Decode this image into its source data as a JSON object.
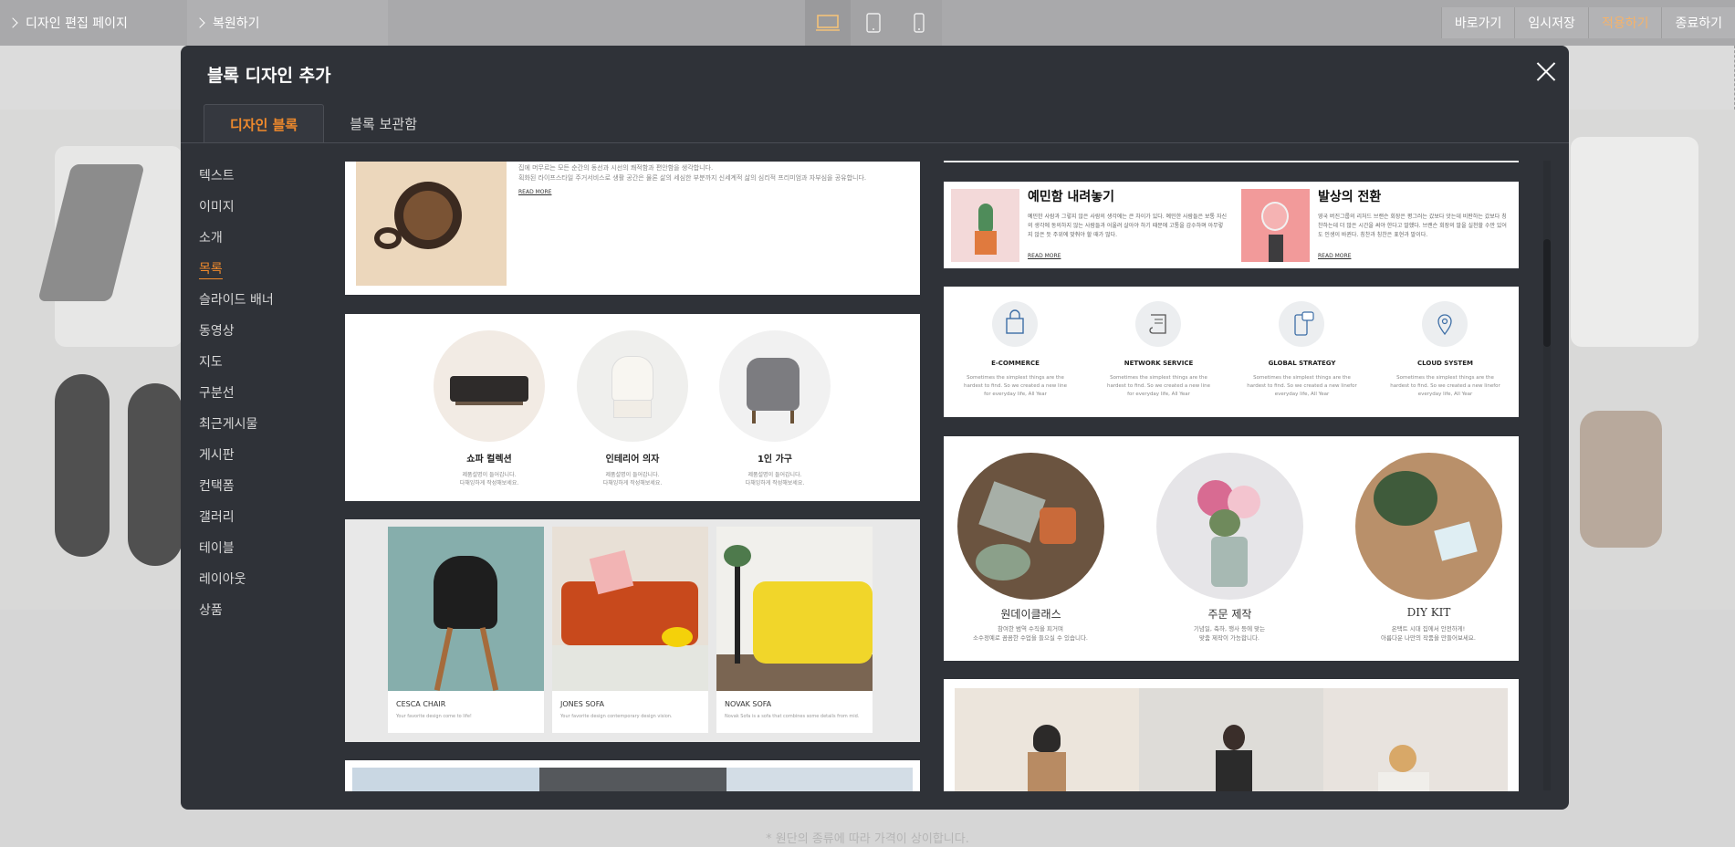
{
  "topbar": {
    "page_name": "디자인 편집 페이지",
    "restore": "복원하기",
    "actions": [
      "바로가기",
      "임시저장",
      "적용하기",
      "종료하기"
    ]
  },
  "background": {
    "price_note": "* 원단의 종류에 따라 가격이 상이합니다."
  },
  "modal": {
    "title": "블록 디자인 추가",
    "tabs": [
      "디자인 블록",
      "블록 보관함"
    ],
    "categories": [
      "텍스트",
      "이미지",
      "소개",
      "목록",
      "슬라이드 배너",
      "동영상",
      "지도",
      "구분선",
      "최근게시물",
      "게시판",
      "컨택폼",
      "갤러리",
      "테이블",
      "레이아웃",
      "상품"
    ]
  },
  "blocks": {
    "coffee": {
      "line1": "집에 머무르는 모든 순간의 동선과 시선의 쾌적함과 편안함을 생각합니다.",
      "line2": "획화된 라이프스타일 주거서비스로 생활 공간은 물론 삶의 세심한 부분까지 신세계적 삶의 심리적 프리미엄과 자부심을 공유합니다.",
      "readmore": "READ MORE"
    },
    "furniture": {
      "items": [
        {
          "title": "쇼파 컬렉션",
          "desc1": "제품설명이 들어갑니다.",
          "desc2": "다채잉하게 작성해보세요."
        },
        {
          "title": "인테리어 의자",
          "desc1": "제품설명이 들어갑니다.",
          "desc2": "다채잉하게 작성해보세요."
        },
        {
          "title": "1인 가구",
          "desc1": "제품설명이 들어갑니다.",
          "desc2": "다채잉하게 작성해보세요."
        }
      ]
    },
    "products": {
      "items": [
        {
          "name": "CESCA CHAIR",
          "desc": "Your favorite design come to life!"
        },
        {
          "name": "JONES SOFA",
          "desc": "Your favorite design contemporary design vision."
        },
        {
          "name": "NOVAK SOFA",
          "desc": "Novak Sofa is a sofa that combines some details from mid."
        }
      ]
    },
    "two_col": {
      "items": [
        {
          "title": "예민함 내려놓기",
          "text": "예민한 사람과 그렇지 않은 사람의 생각에는 큰 차이가 있다. 예민한 사람들은 보통 자신의 생각에 동의하지 않는 사람들과 어울려 살아야 하기 때문에 고통을 감수하며 아무렇지 않은 듯 주위에 맞춰야 할 때가 많다.",
          "readmore": "READ MORE"
        },
        {
          "title": "발상의 전환",
          "text": "영국 버진그룹의 리처드 브랜슨 회장은 평그러는 갔보다 앗는데 비판하는 갔보다 칭찬하는데 더 많은 시간을 써야 한다고 말했다. 브랜슨 회장의 말을 실천할 수만 있어도 인생이 바뀐다. 칭찬과 칭찬은 표현과 말이다.",
          "readmore": "READ MORE"
        }
      ]
    },
    "icons": {
      "items": [
        {
          "icon": "shopping-bag-icon",
          "title": "E-COMMERCE",
          "desc": "Sometimes the simplest things are the hardest to find. So we created a new line for everyday life, All Year"
        },
        {
          "icon": "scroll-icon",
          "title": "NETWORK SERVICE",
          "desc": "Sometimes the simplest things are the hardest to find. So we created a new line for everyday life, All Year"
        },
        {
          "icon": "phone-chat-icon",
          "title": "GLOBAL STRATEGY",
          "desc": "Sometimes the simplest things are the hardest to find. So we created a new linefor everyday life, All Year"
        },
        {
          "icon": "map-pin-icon",
          "title": "CLOUD SYSTEM",
          "desc": "Sometimes the simplest things are the hardest to find. So we created a new linefor everyday life, All Year"
        }
      ]
    },
    "flowers": {
      "items": [
        {
          "title": "원데이클래스",
          "desc1": "참여한 범역 수직을 피거며",
          "desc2": "소수정예로 꼼꼼한 수업을 들으실 수 있습니다."
        },
        {
          "title": "주문 제작",
          "desc1": "기념일, 축하, 행사 등에 맞는",
          "desc2": "맞춤 제작이 가능합니다."
        },
        {
          "title": "DIY KIT",
          "desc1": "온택트 시대 집에서 안전하게!",
          "desc2": "아름다운 나만의 작품을 만들어보세요."
        }
      ]
    }
  },
  "colors": {
    "accent": "#f08a2c",
    "modal_bg": "#2f3238"
  }
}
